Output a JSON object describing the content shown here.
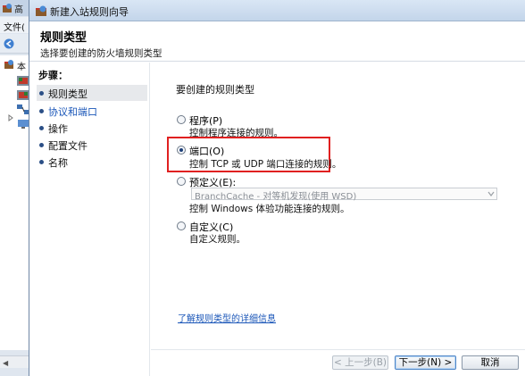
{
  "background_window": {
    "title": "高",
    "menu_label": "文件(",
    "tree_root_label": "本"
  },
  "dialog": {
    "title": "新建入站规则向导",
    "header_title": "规则类型",
    "header_subtitle": "选择要创建的防火墙规则类型",
    "steps_title": "步骤：",
    "steps": [
      {
        "label": "规则类型",
        "active": true,
        "link": false
      },
      {
        "label": "协议和端口",
        "active": false,
        "link": true
      },
      {
        "label": "操作",
        "active": false,
        "link": false
      },
      {
        "label": "配置文件",
        "active": false,
        "link": false
      },
      {
        "label": "名称",
        "active": false,
        "link": false
      }
    ],
    "prompt": "要创建的规则类型",
    "options": {
      "program": {
        "label": "程序(P)",
        "desc": "控制程序连接的规则。",
        "checked": false
      },
      "port": {
        "label": "端口(O)",
        "desc": "控制 TCP 或 UDP 端口连接的规则。",
        "checked": true
      },
      "predefined": {
        "label": "预定义(E):",
        "select_value": "BranchCache - 对等机发现(使用 WSD)",
        "desc": "控制 Windows 体验功能连接的规则。",
        "checked": false
      },
      "custom": {
        "label": "自定义(C)",
        "desc": "自定义规则。",
        "checked": false
      }
    },
    "learn_more_link": "了解规则类型的详细信息",
    "buttons": {
      "back": "< 上一步(B)",
      "next": "下一步(N) >",
      "cancel": "取消"
    }
  },
  "colors": {
    "highlight_box": "#e02020",
    "link": "#1a56b8"
  }
}
